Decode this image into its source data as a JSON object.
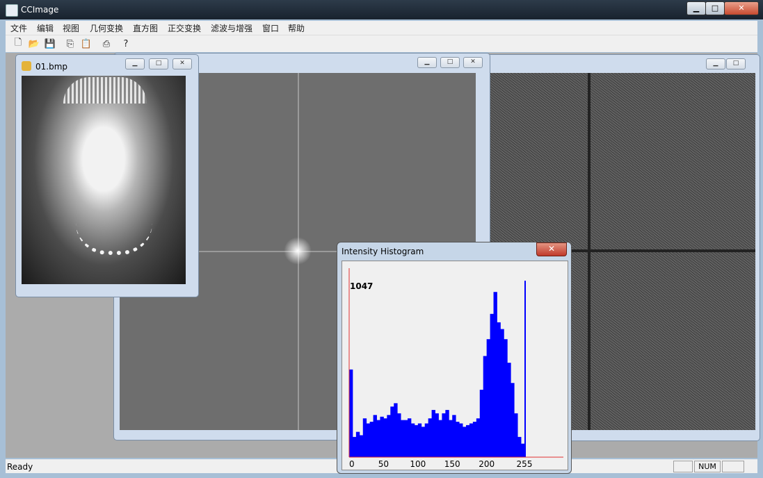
{
  "app": {
    "title": "CCImage"
  },
  "menu": [
    "文件",
    "编辑",
    "视图",
    "几何变换",
    "直方图",
    "正交变换",
    "滤波与增强",
    "窗口",
    "帮助"
  ],
  "toolbar_icons": [
    "new-file-icon",
    "open-folder-icon",
    "save-icon",
    "copy-icon",
    "paste-icon",
    "print-icon",
    "help-icon"
  ],
  "image_window": {
    "title": "01.bmp"
  },
  "histogram": {
    "title": "Intensity Histogram",
    "close_label": "✕",
    "max_label": "1047",
    "colors": {
      "bars": "#0000ff",
      "axis": "#e03030",
      "guide": "#30b030"
    }
  },
  "chart_data": {
    "type": "bar",
    "title": "Intensity Histogram",
    "xlim": [
      0,
      255
    ],
    "ylim": [
      0,
      1047
    ],
    "xticks": [
      "0",
      "50",
      "100",
      "150",
      "200",
      "255"
    ],
    "x": [
      0,
      5,
      10,
      15,
      20,
      25,
      30,
      35,
      40,
      45,
      50,
      55,
      60,
      65,
      70,
      75,
      80,
      85,
      90,
      95,
      100,
      105,
      110,
      115,
      120,
      125,
      130,
      135,
      140,
      145,
      150,
      155,
      160,
      165,
      170,
      175,
      180,
      185,
      190,
      195,
      200,
      205,
      210,
      215,
      220,
      225,
      230,
      235,
      240,
      245,
      250,
      255
    ],
    "values": [
      520,
      120,
      150,
      130,
      230,
      200,
      210,
      250,
      220,
      240,
      230,
      250,
      300,
      320,
      260,
      220,
      220,
      230,
      200,
      190,
      200,
      180,
      200,
      230,
      280,
      260,
      220,
      260,
      280,
      220,
      250,
      210,
      200,
      180,
      190,
      200,
      210,
      230,
      400,
      600,
      700,
      850,
      980,
      800,
      760,
      700,
      560,
      440,
      260,
      120,
      80,
      1047
    ]
  },
  "status": {
    "text": "Ready",
    "num": "NUM"
  }
}
